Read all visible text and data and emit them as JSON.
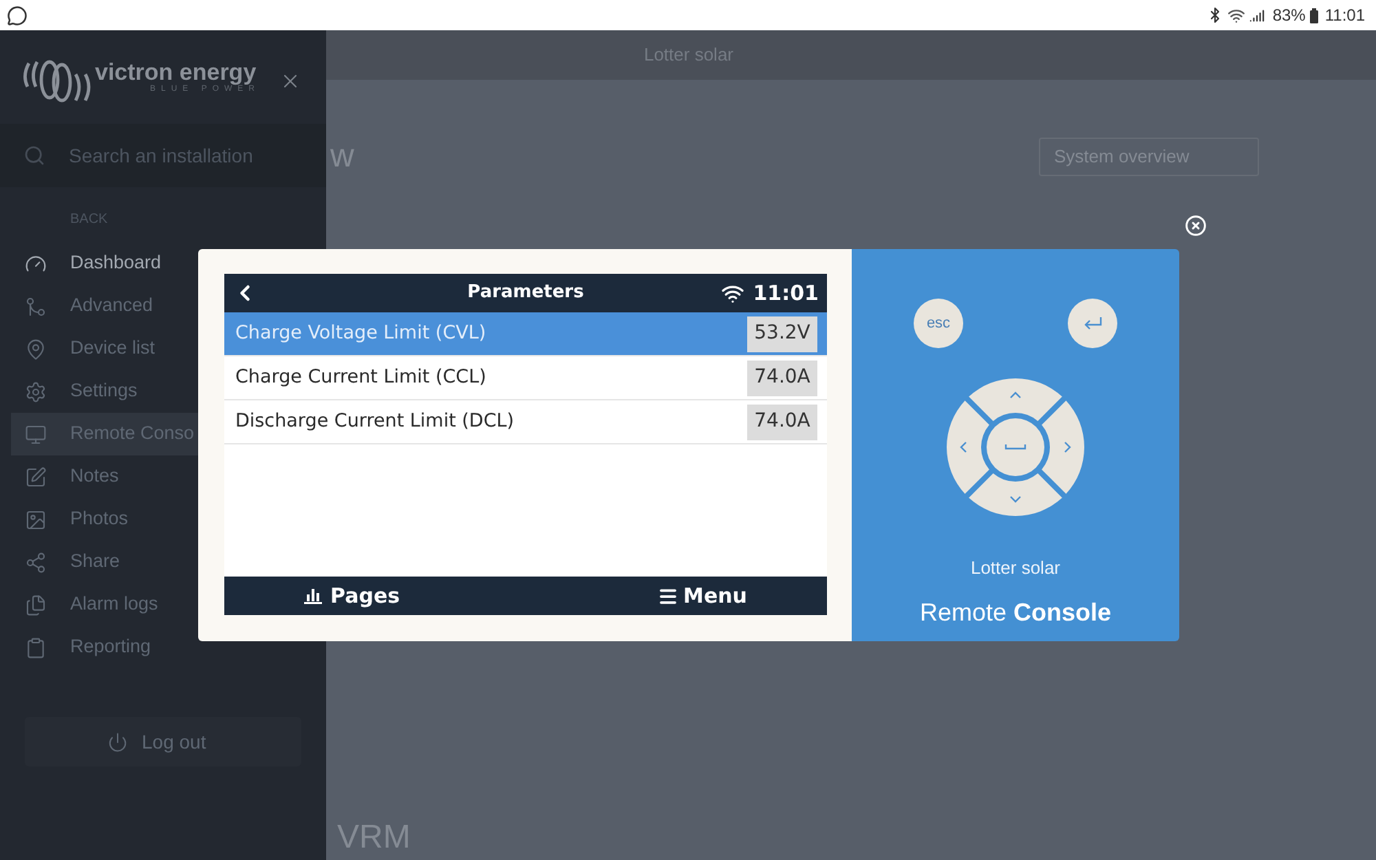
{
  "status_bar": {
    "battery": "83%",
    "time": "11:01"
  },
  "app_header": {
    "title": "Lotter solar"
  },
  "sidebar": {
    "logo": {
      "wordmark": "victron energy",
      "tagline": "BLUE POWER"
    },
    "search": {
      "placeholder": "Search an installation"
    },
    "back_label": "BACK",
    "items": [
      {
        "label": "Dashboard",
        "selected": false,
        "emphasized": true
      },
      {
        "label": "Advanced",
        "selected": false,
        "emphasized": false
      },
      {
        "label": "Device list",
        "selected": false,
        "emphasized": false
      },
      {
        "label": "Settings",
        "selected": false,
        "emphasized": false
      },
      {
        "label": "Remote Conso",
        "selected": true,
        "emphasized": false
      },
      {
        "label": "Notes",
        "selected": false,
        "emphasized": false
      },
      {
        "label": "Photos",
        "selected": false,
        "emphasized": false
      },
      {
        "label": "Share",
        "selected": false,
        "emphasized": false
      },
      {
        "label": "Alarm logs",
        "selected": false,
        "emphasized": false
      },
      {
        "label": "Reporting",
        "selected": false,
        "emphasized": false
      }
    ],
    "logout": {
      "label": "Log out"
    }
  },
  "page": {
    "heading": "w",
    "view_select": {
      "value": "System overview"
    },
    "section_heading": "VRM"
  },
  "remote_console": {
    "screen": {
      "title": "Parameters",
      "time": "11:01",
      "rows": [
        {
          "label": "Charge Voltage Limit (CVL)",
          "value": "53.2V",
          "selected": true
        },
        {
          "label": "Charge Current Limit (CCL)",
          "value": "74.0A",
          "selected": false
        },
        {
          "label": "Discharge Current Limit (DCL)",
          "value": "74.0A",
          "selected": false
        }
      ],
      "footer": {
        "left_button": "Pages",
        "right_button": "Menu"
      }
    },
    "keypad": {
      "escape_key": "esc"
    },
    "installation": "Lotter solar",
    "title": "Remote **Console**"
  }
}
